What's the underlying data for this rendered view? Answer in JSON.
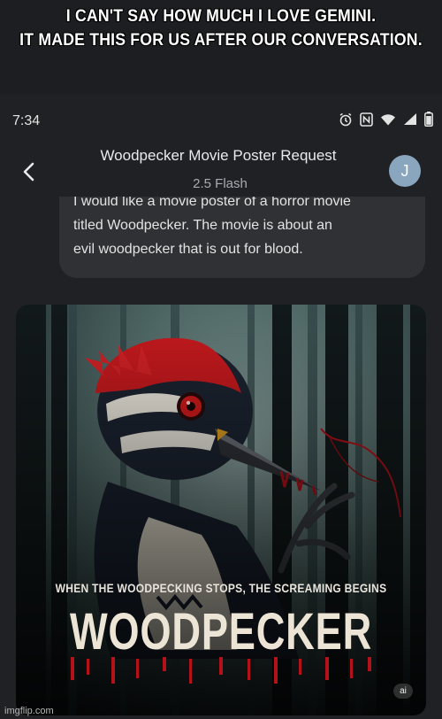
{
  "meme": {
    "caption_line1": "I CAN'T SAY HOW MUCH I LOVE GEMINI.",
    "caption_line2": "IT MADE THIS FOR US AFTER OUR CONVERSATION."
  },
  "status_bar": {
    "time": "7:34",
    "icons": [
      "alarm-icon",
      "nfc-icon",
      "wifi-icon",
      "wifi-off-icon",
      "battery-icon"
    ]
  },
  "header": {
    "title": "Woodpecker Movie Poster Request",
    "model": "2.5 Flash",
    "avatar_initial": "J"
  },
  "message": {
    "line1": "I would like a movie poster of a horror movie",
    "line2": "titled Woodpecker.  The movie is about an",
    "line3": "evil woodpecker that is out for blood."
  },
  "poster": {
    "tagline": "WHEN THE WOODPECKING STOPS, THE SCREAMING BEGINS",
    "title": "WOODPECKER",
    "ai_badge": "ai"
  },
  "watermark": "imgflip.com",
  "colors": {
    "background": "#202124",
    "bubble": "#303134",
    "avatar": "#8aa6bf",
    "blood": "#b3121a",
    "crest": "#c81a1e"
  }
}
